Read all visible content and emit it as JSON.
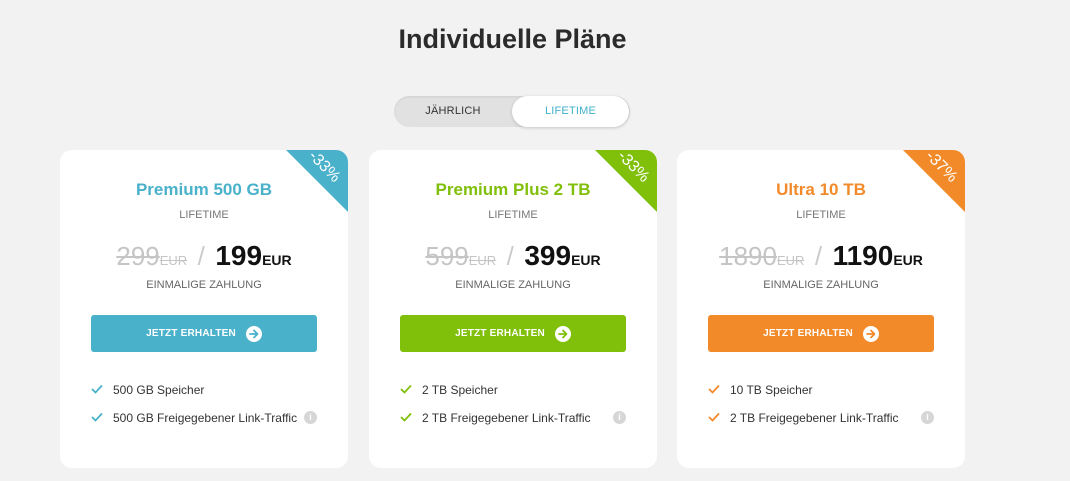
{
  "page": {
    "title": "Individuelle Pläne"
  },
  "billing_toggle": {
    "options": [
      "JÄHRLICH",
      "LIFETIME"
    ],
    "selected": "LIFETIME"
  },
  "plans": [
    {
      "name": "Premium 500 GB",
      "period": "LIFETIME",
      "discount": "-33%",
      "old_price": "299",
      "new_price": "199",
      "currency": "EUR",
      "payment_note": "EINMALIGE ZAHLUNG",
      "cta": "JETZT ERHALTEN",
      "accent": "#4ab1cb",
      "features": [
        "500 GB Speicher",
        "500 GB Freigegebener Link-Traffic"
      ]
    },
    {
      "name": "Premium Plus 2 TB",
      "period": "LIFETIME",
      "discount": "-33%",
      "old_price": "599",
      "new_price": "399",
      "currency": "EUR",
      "payment_note": "EINMALIGE ZAHLUNG",
      "cta": "JETZT ERHALTEN",
      "accent": "#80bf0a",
      "features": [
        "2 TB Speicher",
        "2 TB Freigegebener Link-Traffic"
      ]
    },
    {
      "name": "Ultra 10 TB",
      "period": "LIFETIME",
      "discount": "-37%",
      "old_price": "1890",
      "new_price": "1190",
      "currency": "EUR",
      "payment_note": "EINMALIGE ZAHLUNG",
      "cta": "JETZT ERHALTEN",
      "accent": "#f28a2a",
      "features": [
        "10 TB Speicher",
        "2 TB Freigegebener Link-Traffic"
      ]
    }
  ],
  "icons": {
    "feature_check": "check-icon",
    "info": "info-icon",
    "cta_arrow": "arrow-right-circle-icon"
  }
}
